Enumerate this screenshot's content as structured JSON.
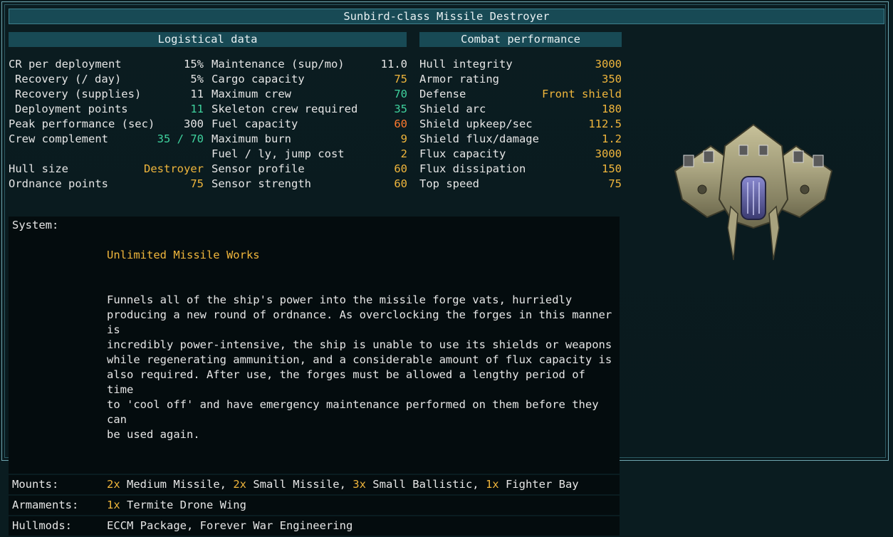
{
  "title": "Sunbird-class Missile Destroyer",
  "sections": {
    "logistical": "Logistical data",
    "combat": "Combat performance"
  },
  "logistics_col1": [
    {
      "label": "CR per deployment",
      "value": "15%",
      "indent": false,
      "color": "white"
    },
    {
      "label": "Recovery (/ day)",
      "value": "5%",
      "indent": true,
      "color": "white"
    },
    {
      "label": "Recovery (supplies)",
      "value": "11",
      "indent": true,
      "color": "white"
    },
    {
      "label": "Deployment points",
      "value": "11",
      "indent": true,
      "color": "green"
    },
    {
      "label": "Peak performance (sec)",
      "value": "300",
      "indent": false,
      "color": "white"
    },
    {
      "label": "Crew complement",
      "value": "35 / 70",
      "indent": false,
      "color": "green"
    },
    {
      "label": "",
      "value": "",
      "indent": false,
      "color": "white"
    },
    {
      "label": "Hull size",
      "value": "Destroyer",
      "indent": false,
      "color": "yellow"
    },
    {
      "label": "Ordnance points",
      "value": "75",
      "indent": false,
      "color": "yellow"
    }
  ],
  "logistics_col2": [
    {
      "label": "Maintenance (sup/mo)",
      "value": "11.0",
      "color": "white"
    },
    {
      "label": "Cargo capacity",
      "value": "75",
      "color": "yellow"
    },
    {
      "label": "Maximum crew",
      "value": "70",
      "color": "green"
    },
    {
      "label": "Skeleton crew required",
      "value": "35",
      "color": "green"
    },
    {
      "label": "Fuel capacity",
      "value": "60",
      "color": "orange"
    },
    {
      "label": "Maximum burn",
      "value": "9",
      "color": "yellow"
    },
    {
      "label": "Fuel / ly, jump cost",
      "value": "2",
      "color": "yellow"
    },
    {
      "label": "Sensor profile",
      "value": "60",
      "color": "yellow"
    },
    {
      "label": "Sensor strength",
      "value": "60",
      "color": "yellow"
    }
  ],
  "combat": [
    {
      "label": "Hull integrity",
      "value": "3000",
      "color": "yellow"
    },
    {
      "label": "Armor rating",
      "value": "350",
      "color": "yellow"
    },
    {
      "label": "Defense",
      "value": "Front shield",
      "color": "yellow"
    },
    {
      "label": "Shield arc",
      "value": "180",
      "color": "yellow"
    },
    {
      "label": "Shield upkeep/sec",
      "value": "112.5",
      "color": "yellow"
    },
    {
      "label": "Shield flux/damage",
      "value": "1.2",
      "color": "yellow"
    },
    {
      "label": "Flux capacity",
      "value": "3000",
      "color": "yellow"
    },
    {
      "label": "Flux dissipation",
      "value": "150",
      "color": "yellow"
    },
    {
      "label": "Top speed",
      "value": "75",
      "color": "yellow"
    }
  ],
  "system": {
    "key": "System:",
    "name": "Unlimited Missile Works",
    "description": "Funnels all of the ship's power into the missile forge vats, hurriedly\nproducing a new round of ordnance. As overclocking the forges in this manner is\nincredibly power-intensive, the ship is unable to use its shields or weapons\nwhile regenerating ammunition, and a considerable amount of flux capacity is\nalso required. After use, the forges must be allowed a lengthy period of time\nto 'cool off' and have emergency maintenance performed on them before they can\nbe used again."
  },
  "mounts": {
    "key": "Mounts:",
    "items": [
      {
        "count": "2x",
        "text": " Medium Missile, "
      },
      {
        "count": "2x",
        "text": " Small Missile, "
      },
      {
        "count": "3x",
        "text": " Small Ballistic, "
      },
      {
        "count": "1x",
        "text": " Fighter Bay"
      }
    ]
  },
  "armaments": {
    "key": "Armaments:",
    "count": "1x",
    "text": " Termite Drone Wing"
  },
  "hullmods": {
    "key": "Hullmods:",
    "text": "ECCM Package, Forever War Engineering"
  },
  "colors": {
    "white": "#e6e6e6",
    "green": "#3fd29e",
    "yellow": "#f0b63c",
    "orange": "#ff7a2e",
    "header_bg": "#184a55"
  },
  "icons": {
    "ship": "sunbird-ship-icon"
  }
}
